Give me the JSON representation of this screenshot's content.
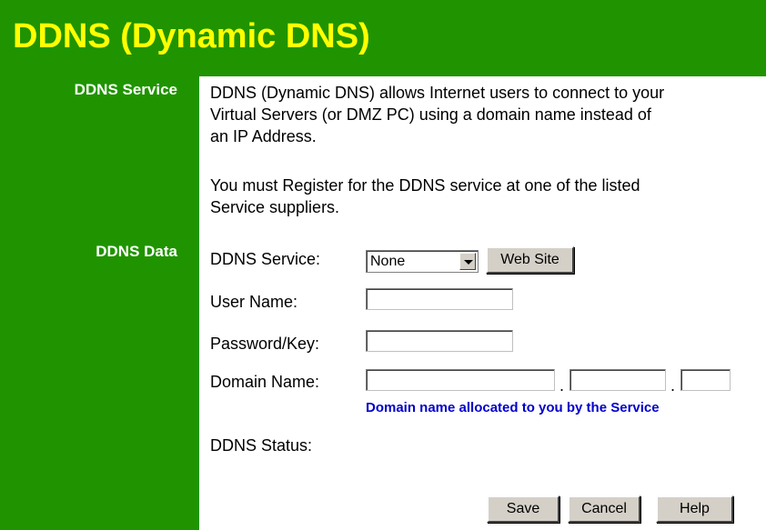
{
  "page": {
    "title": "DDNS (Dynamic DNS)"
  },
  "sections": {
    "service_label": "DDNS Service",
    "data_label": "DDNS Data"
  },
  "intro": {
    "line1": "DDNS (Dynamic DNS) allows Internet users to connect to your",
    "line2": "Virtual Servers (or DMZ PC) using a domain name instead of",
    "line3": "an IP Address.",
    "line4": "You must Register for the DDNS service at one of the listed",
    "line5": "Service suppliers."
  },
  "form": {
    "ddns_service_label": "DDNS Service:",
    "ddns_service_value": "None",
    "website_button": "Web Site",
    "username_label": "User Name:",
    "username_value": "",
    "password_label": "Password/Key:",
    "password_value": "",
    "domain_label": "Domain Name:",
    "domain_part1": "",
    "domain_part2": "",
    "domain_part3": "",
    "domain_separator": ".",
    "domain_hint": "Domain name allocated to you by the Service",
    "status_label": "DDNS Status:",
    "status_value": ""
  },
  "buttons": {
    "save": "Save",
    "cancel": "Cancel",
    "help": "Help"
  },
  "colors": {
    "sidebar_green": "#1f9400",
    "title_yellow": "#ffff00",
    "hint_blue": "#0000cc"
  }
}
